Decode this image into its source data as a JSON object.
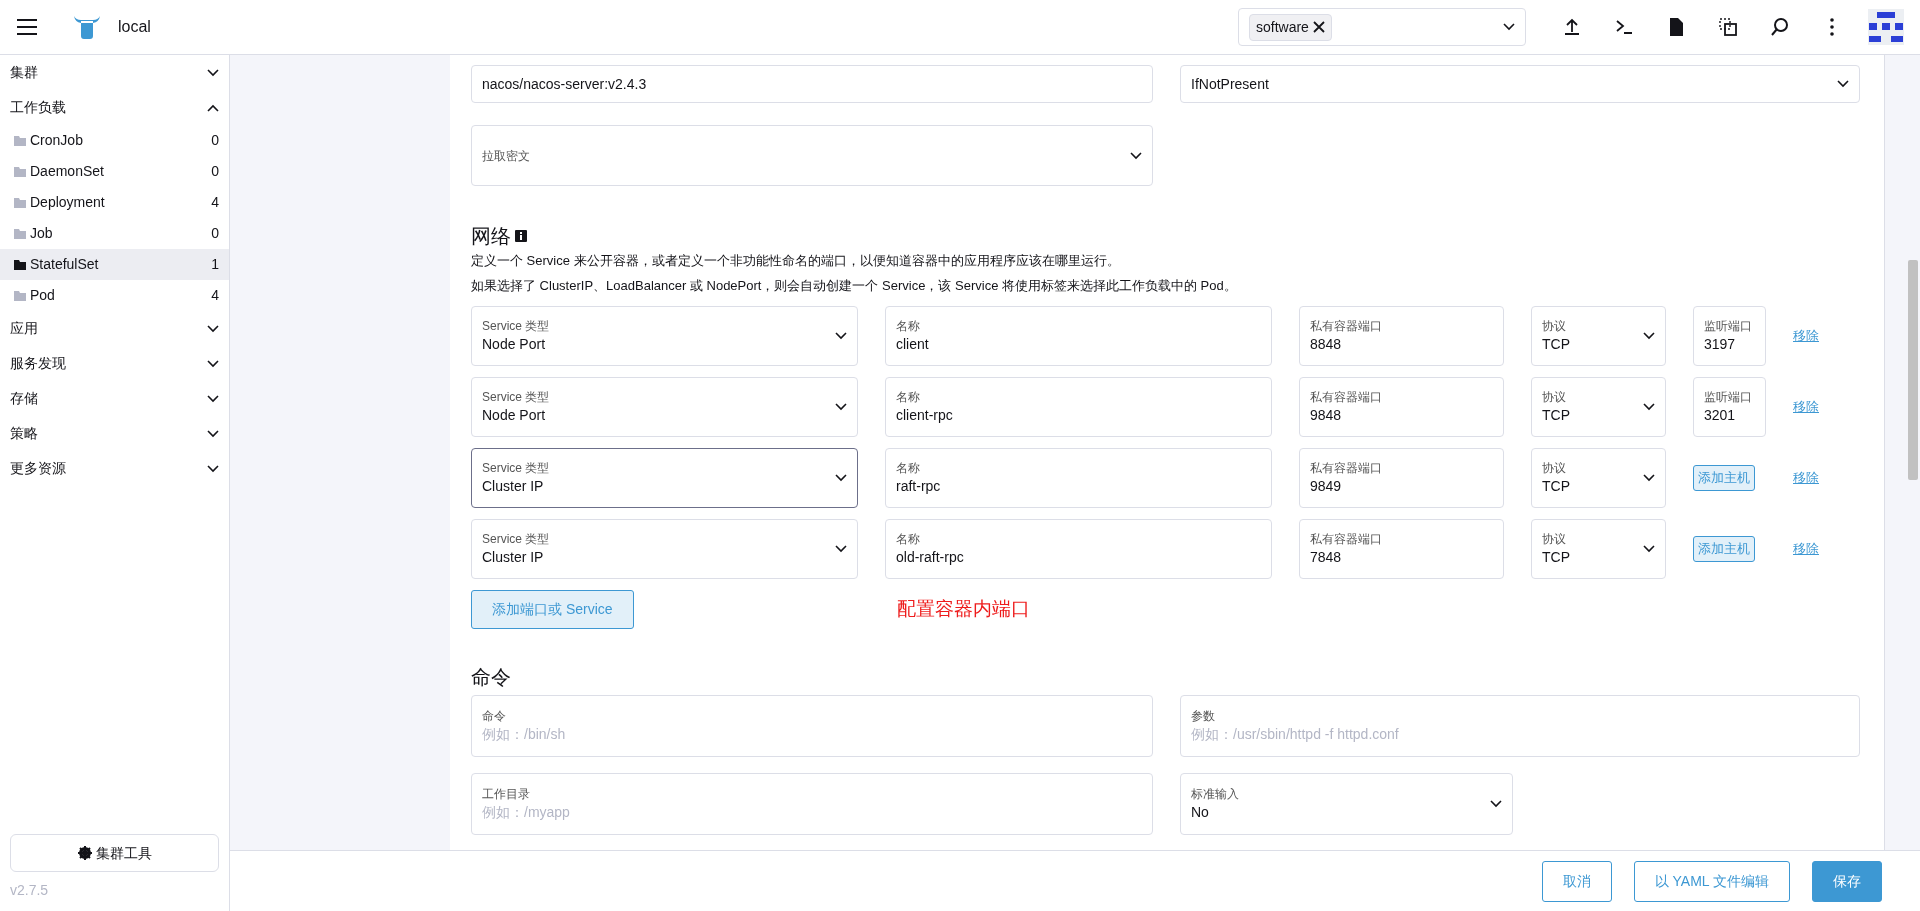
{
  "header": {
    "title": "local",
    "namespace_filter": {
      "chips": [
        "software"
      ]
    }
  },
  "sidebar": {
    "groups": [
      {
        "label": "集群",
        "expanded": false
      },
      {
        "label": "工作负载",
        "expanded": true,
        "children": [
          {
            "label": "CronJob",
            "count": "0",
            "selected": false
          },
          {
            "label": "DaemonSet",
            "count": "0",
            "selected": false
          },
          {
            "label": "Deployment",
            "count": "4",
            "selected": false
          },
          {
            "label": "Job",
            "count": "0",
            "selected": false
          },
          {
            "label": "StatefulSet",
            "count": "1",
            "selected": true
          },
          {
            "label": "Pod",
            "count": "4",
            "selected": false
          }
        ]
      },
      {
        "label": "应用",
        "expanded": false
      },
      {
        "label": "服务发现",
        "expanded": false
      },
      {
        "label": "存储",
        "expanded": false
      },
      {
        "label": "策略",
        "expanded": false
      },
      {
        "label": "更多资源",
        "expanded": false
      }
    ],
    "tool_button": "集群工具",
    "version": "v2.7.5"
  },
  "form": {
    "image_fields": [
      {
        "kind": "input",
        "value": "nacos/nacos-server:v2.4.3"
      },
      {
        "kind": "select",
        "value": "IfNotPresent"
      }
    ],
    "pull_secret": {
      "label": "拉取密文"
    },
    "network": {
      "title": "网络",
      "descriptions": [
        "定义一个 Service 来公开容器，或者定义一个非功能性命名的端口，以便知道容器中的应用程序应该在哪里运行。",
        "如果选择了 ClusterIP、LoadBalancer 或 NodePort，则会自动创建一个 Service，该 Service 将使用标签来选择此工作负载中的 Pod。"
      ],
      "ports": [
        {
          "service_type_label": "Service 类型",
          "service_type": "Node Port",
          "focused": false,
          "name_label": "名称",
          "name": "client",
          "port_label": "私有容器端口",
          "port": "8848",
          "protocol_label": "协议",
          "protocol": "TCP",
          "listen": {
            "kind": "input",
            "label": "监听端口",
            "value": "3197"
          },
          "remove": "移除"
        },
        {
          "service_type_label": "Service 类型",
          "service_type": "Node Port",
          "focused": false,
          "name_label": "名称",
          "name": "client-rpc",
          "port_label": "私有容器端口",
          "port": "9848",
          "protocol_label": "协议",
          "protocol": "TCP",
          "listen": {
            "kind": "input",
            "label": "监听端口",
            "value": "3201"
          },
          "remove": "移除"
        },
        {
          "service_type_label": "Service 类型",
          "service_type": "Cluster IP",
          "focused": true,
          "name_label": "名称",
          "name": "raft-rpc",
          "port_label": "私有容器端口",
          "port": "9849",
          "protocol_label": "协议",
          "protocol": "TCP",
          "listen": {
            "kind": "button",
            "label": "添加主机"
          },
          "remove": "移除"
        },
        {
          "service_type_label": "Service 类型",
          "service_type": "Cluster IP",
          "focused": false,
          "name_label": "名称",
          "name": "old-raft-rpc",
          "port_label": "私有容器端口",
          "port": "7848",
          "protocol_label": "协议",
          "protocol": "TCP",
          "listen": {
            "kind": "button",
            "label": "添加主机"
          },
          "remove": "移除"
        }
      ],
      "add_button": "添加端口或 Service",
      "annotation": "配置容器内端口"
    },
    "command": {
      "title": "命令",
      "fields": [
        {
          "kind": "input",
          "label": "命令",
          "placeholder": "例如：/bin/sh"
        },
        {
          "kind": "input",
          "label": "参数",
          "placeholder": "例如：/usr/sbin/httpd -f httpd.conf"
        },
        {
          "kind": "input",
          "label": "工作目录",
          "placeholder": "例如：/myapp"
        },
        {
          "kind": "select",
          "label": "标准输入",
          "value": "No"
        }
      ]
    }
  },
  "footer": {
    "buttons": [
      {
        "kind": "outline",
        "label": "取消"
      },
      {
        "kind": "outline",
        "label": "以 YAML 文件编辑"
      },
      {
        "kind": "primary",
        "label": "保存"
      }
    ]
  }
}
